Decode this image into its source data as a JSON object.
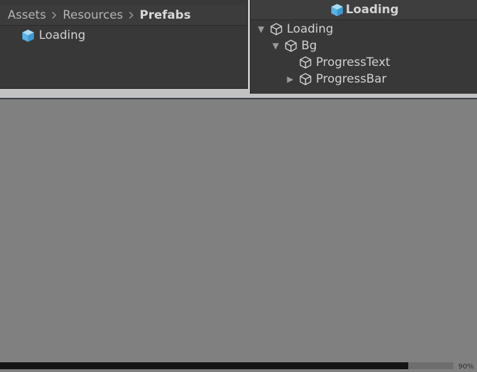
{
  "project": {
    "breadcrumb": [
      "Assets",
      "Resources",
      "Prefabs"
    ],
    "asset": {
      "label": "Loading",
      "icon": "prefab-cube-icon"
    }
  },
  "hierarchy": {
    "prefab_title": "Loading",
    "items": [
      {
        "label": "Loading",
        "arrow": "expanded"
      },
      {
        "label": "Bg",
        "arrow": "expanded"
      },
      {
        "label": "ProgressText",
        "arrow": "none"
      },
      {
        "label": "ProgressBar",
        "arrow": "collapsed"
      }
    ]
  },
  "game": {
    "progress": 0.9,
    "progress_text": "90%"
  },
  "colors": {
    "prefab_blue": "#7bc6ef",
    "panel_bg": "#383838",
    "game_bg": "#808080"
  }
}
